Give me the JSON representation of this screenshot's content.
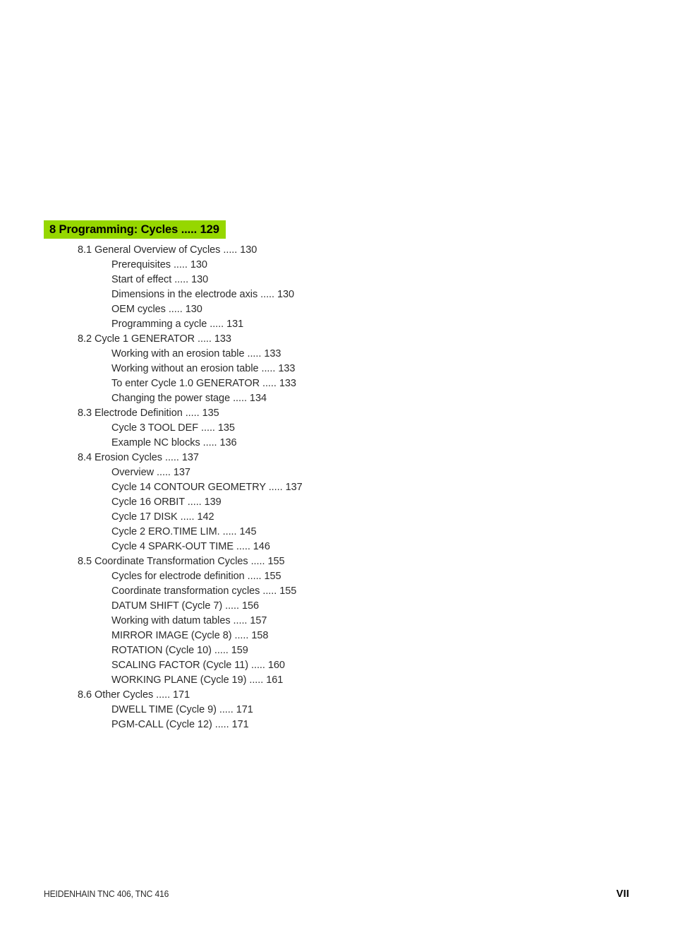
{
  "chapter": {
    "heading": "8 Programming: Cycles ..... 129",
    "highlight_color": "#96d700"
  },
  "toc": {
    "entries": [
      {
        "level": 1,
        "text": "8.1 General Overview of Cycles ..... 130"
      },
      {
        "level": 2,
        "text": "Prerequisites ..... 130"
      },
      {
        "level": 2,
        "text": "Start of effect ..... 130"
      },
      {
        "level": 2,
        "text": "Dimensions in the electrode axis ..... 130"
      },
      {
        "level": 2,
        "text": "OEM cycles ..... 130"
      },
      {
        "level": 2,
        "text": "Programming a cycle ..... 131"
      },
      {
        "level": 1,
        "text": "8.2 Cycle 1 GENERATOR ..... 133"
      },
      {
        "level": 2,
        "text": "Working with an erosion table ..... 133"
      },
      {
        "level": 2,
        "text": "Working without an erosion table ..... 133"
      },
      {
        "level": 2,
        "text": "To enter Cycle 1.0 GENERATOR ..... 133"
      },
      {
        "level": 2,
        "text": "Changing the power stage ..... 134"
      },
      {
        "level": 1,
        "text": "8.3 Electrode Definition ..... 135"
      },
      {
        "level": 2,
        "text": "Cycle 3 TOOL DEF ..... 135"
      },
      {
        "level": 2,
        "text": "Example NC blocks ..... 136"
      },
      {
        "level": 1,
        "text": "8.4 Erosion Cycles ..... 137"
      },
      {
        "level": 2,
        "text": "Overview ..... 137"
      },
      {
        "level": 2,
        "text": "Cycle 14 CONTOUR GEOMETRY ..... 137"
      },
      {
        "level": 2,
        "text": "Cycle 16 ORBIT ..... 139"
      },
      {
        "level": 2,
        "text": "Cycle 17 DISK ..... 142"
      },
      {
        "level": 2,
        "text": "Cycle 2 ERO.TIME LIM. ..... 145"
      },
      {
        "level": 2,
        "text": "Cycle 4 SPARK-OUT TIME ..... 146"
      },
      {
        "level": 1,
        "text": "8.5 Coordinate Transformation Cycles ..... 155"
      },
      {
        "level": 2,
        "text": "Cycles for electrode definition ..... 155"
      },
      {
        "level": 2,
        "text": "Coordinate transformation cycles ..... 155"
      },
      {
        "level": 2,
        "text": "DATUM SHIFT (Cycle 7) ..... 156"
      },
      {
        "level": 2,
        "text": "Working with datum tables ..... 157"
      },
      {
        "level": 2,
        "text": "MIRROR IMAGE (Cycle 8) ..... 158"
      },
      {
        "level": 2,
        "text": "ROTATION (Cycle 10) ..... 159"
      },
      {
        "level": 2,
        "text": "SCALING FACTOR (Cycle 11) ..... 160"
      },
      {
        "level": 2,
        "text": "WORKING PLANE (Cycle 19) ..... 161"
      },
      {
        "level": 1,
        "text": "8.6 Other Cycles ..... 171"
      },
      {
        "level": 2,
        "text": "DWELL TIME (Cycle 9) ..... 171"
      },
      {
        "level": 2,
        "text": "PGM-CALL (Cycle 12) ..... 171"
      }
    ]
  },
  "footer": {
    "product": "HEIDENHAIN TNC 406, TNC 416",
    "page_number": "VII"
  }
}
